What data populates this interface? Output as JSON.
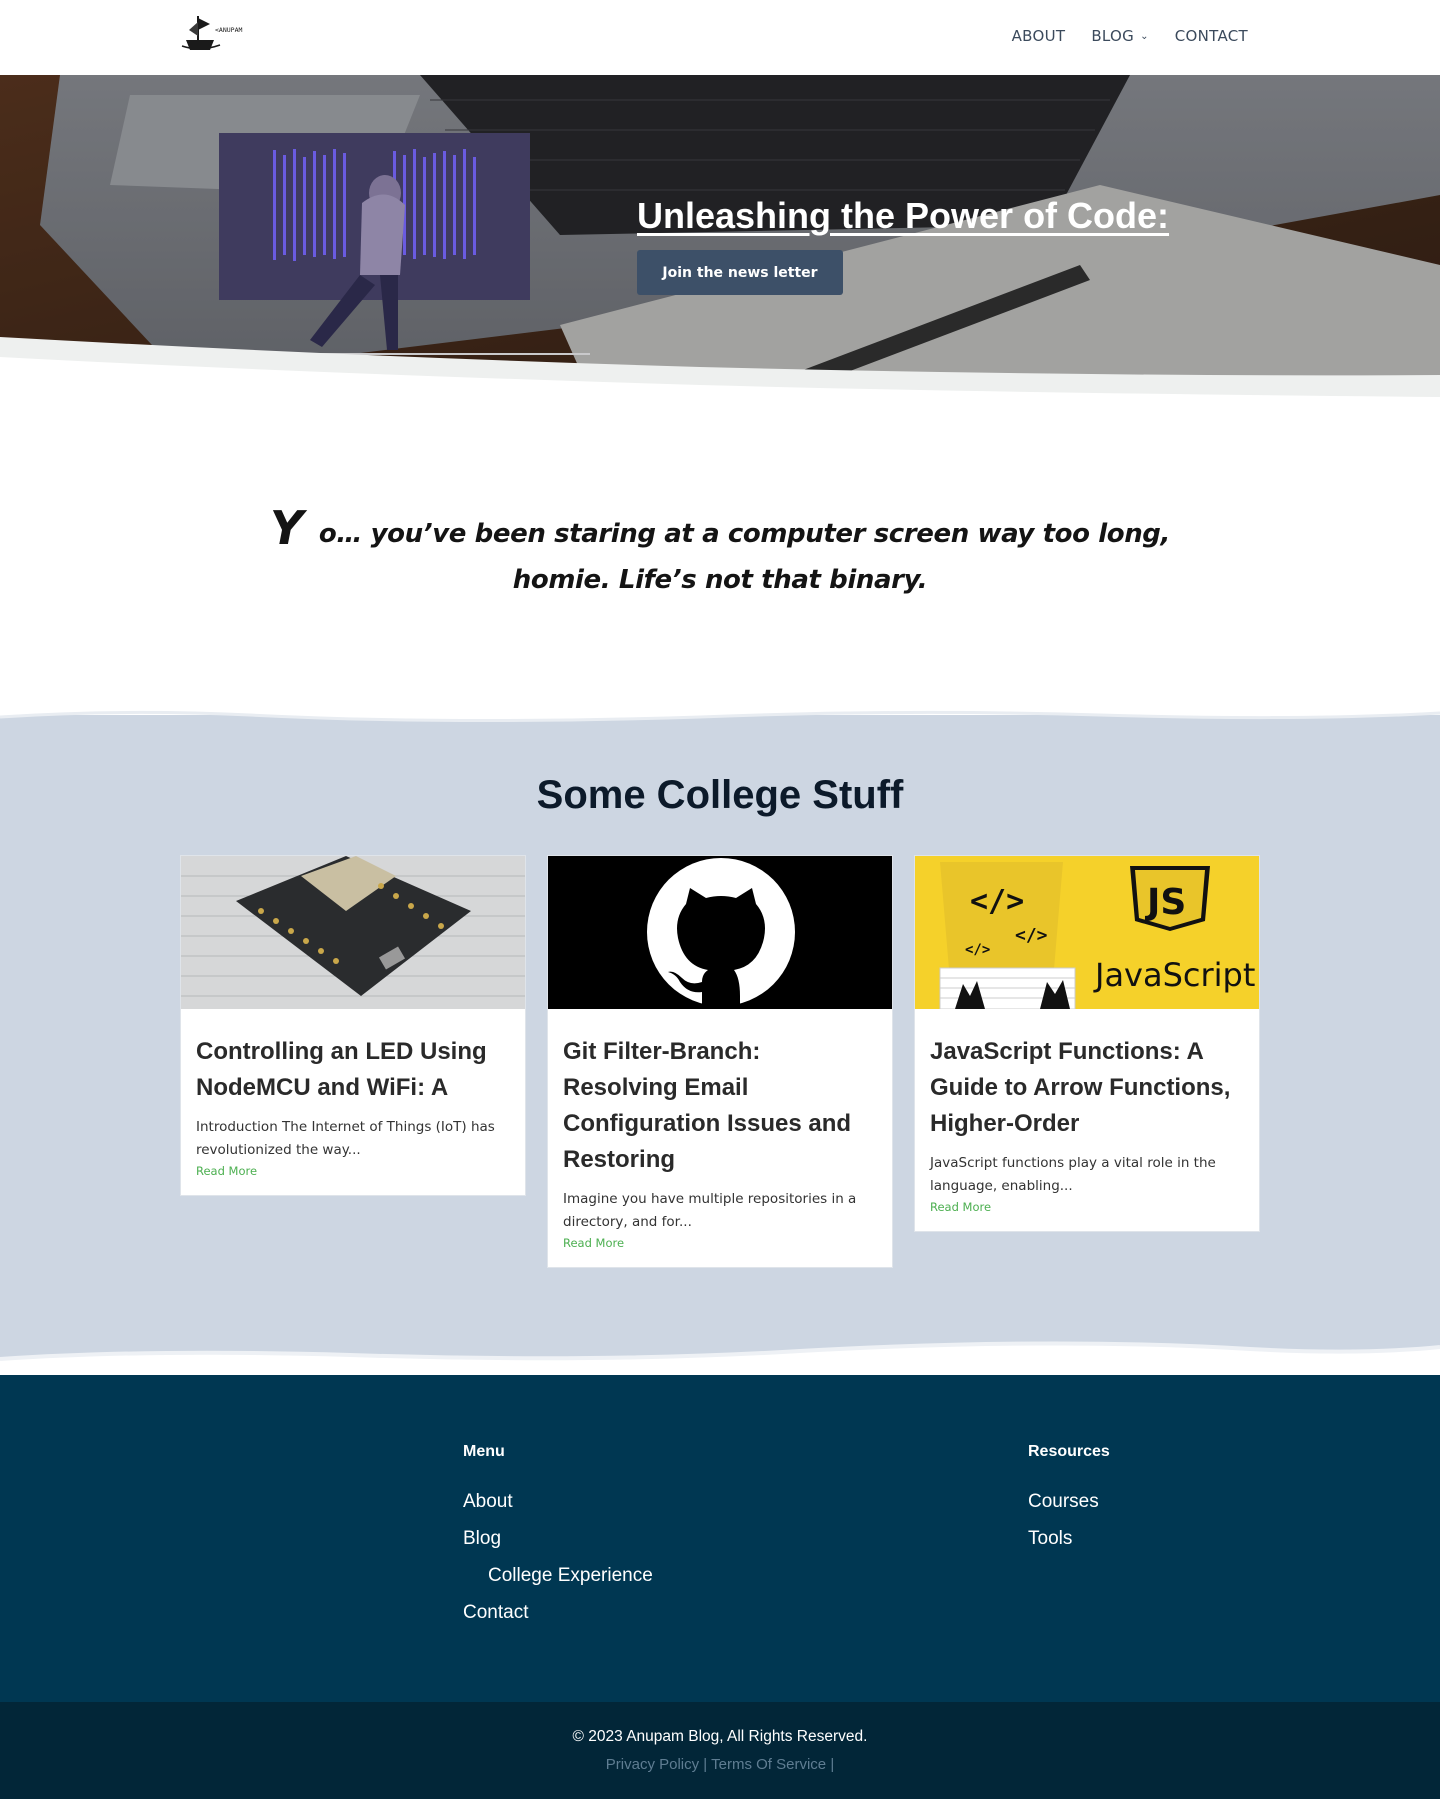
{
  "header": {
    "logo_text": "<ANUPAM />",
    "nav": [
      {
        "label": "ABOUT"
      },
      {
        "label": "BLOG",
        "has_dropdown": true
      },
      {
        "label": "CONTACT"
      }
    ]
  },
  "hero": {
    "title": "Unleashing the Power of Code:",
    "button_label": "Join the news letter",
    "button_color": "#3d5068"
  },
  "quote": {
    "first_letter": "Y",
    "text": "o… you’ve been staring at a computer screen way too long, homie. Life’s not that binary."
  },
  "college": {
    "title": "Some College Stuff",
    "background": "#cdd6e2",
    "cards": [
      {
        "image": "nodemcu-board",
        "title": "Controlling an LED Using NodeMCU and WiFi: A",
        "excerpt": "Introduction The Internet of Things (IoT) has revolutionized the way...",
        "read_more": "Read More"
      },
      {
        "image": "github-octocat-logo",
        "title": "Git Filter-Branch: Resolving Email Configuration Issues and Restoring",
        "excerpt": "Imagine you have multiple repositories in a directory, and for...",
        "read_more": "Read More"
      },
      {
        "image": "javascript-banner",
        "image_text": "JavaScript",
        "title": "JavaScript Functions: A Guide to Arrow Functions, Higher-Order",
        "excerpt": "JavaScript functions play a vital role in the language, enabling...",
        "read_more": "Read More"
      }
    ]
  },
  "footer": {
    "background": "#003752",
    "menu": {
      "heading": "Menu",
      "links": [
        {
          "label": "About"
        },
        {
          "label": "Blog"
        },
        {
          "label": "College Experience"
        },
        {
          "label": "Contact"
        }
      ]
    },
    "resources": {
      "heading": "Resources",
      "links": [
        {
          "label": "Courses"
        },
        {
          "label": "Tools"
        }
      ]
    },
    "copyright": "© 2023 Anupam Blog, All Rights Reserved.",
    "legal": [
      {
        "label": "Privacy Policy"
      },
      {
        "label": "Terms Of Service"
      }
    ],
    "legal_separator": "|"
  }
}
